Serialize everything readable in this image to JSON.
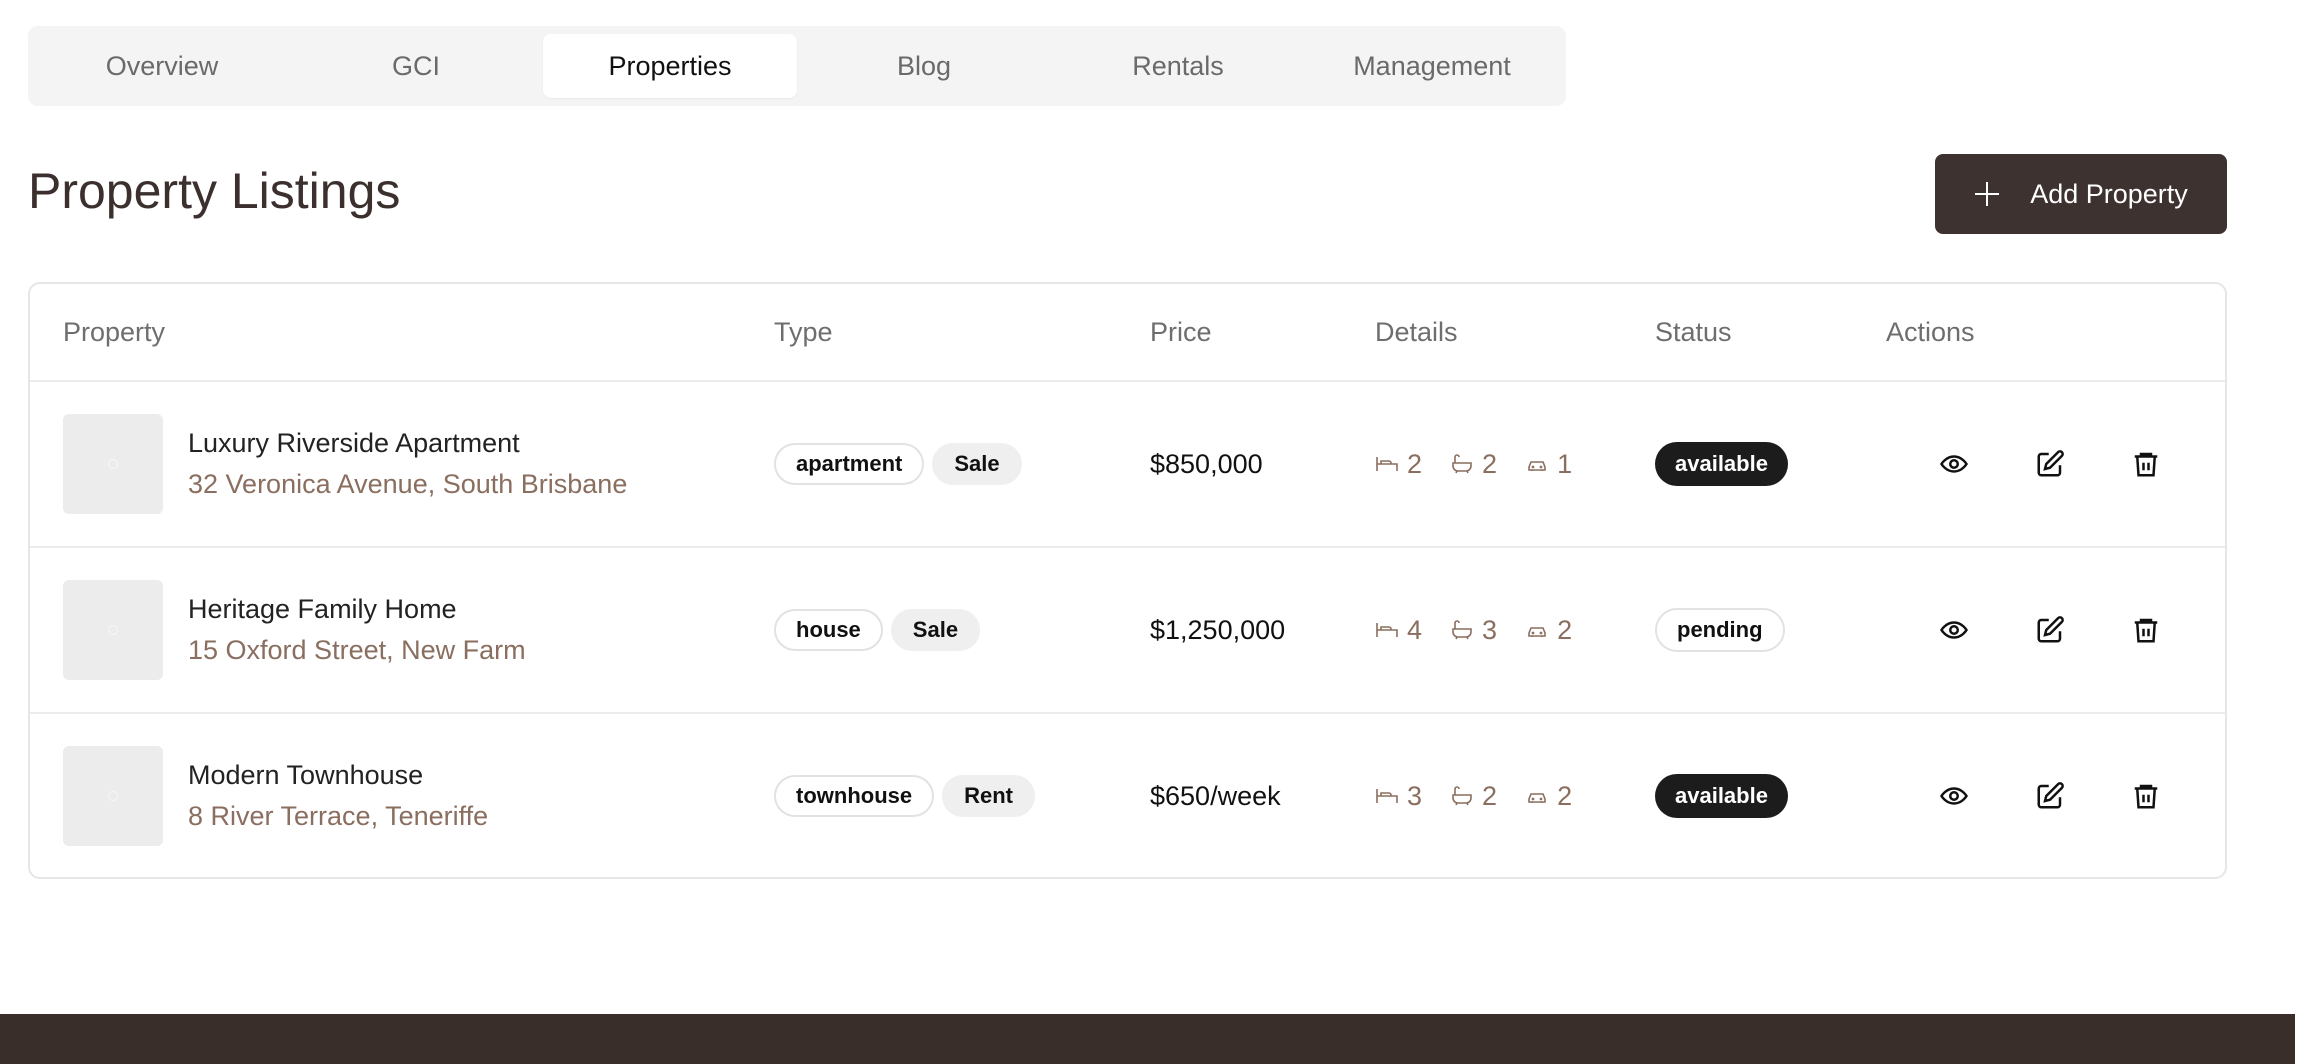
{
  "tabs": [
    {
      "label": "Overview",
      "active": false
    },
    {
      "label": "GCI",
      "active": false
    },
    {
      "label": "Properties",
      "active": true
    },
    {
      "label": "Blog",
      "active": false
    },
    {
      "label": "Rentals",
      "active": false
    },
    {
      "label": "Management",
      "active": false
    }
  ],
  "header": {
    "title": "Property Listings",
    "add_button_label": "Add Property",
    "add_button_icon": "plus-icon"
  },
  "table": {
    "columns": [
      "Property",
      "Type",
      "Price",
      "Details",
      "Status",
      "Actions"
    ],
    "rows": [
      {
        "name": "Luxury Riverside Apartment",
        "address": "32 Veronica Avenue, South Brisbane",
        "type": "apartment",
        "listing": "Sale",
        "price": "$850,000",
        "beds": "2",
        "baths": "2",
        "cars": "1",
        "status": "available"
      },
      {
        "name": "Heritage Family Home",
        "address": "15 Oxford Street, New Farm",
        "type": "house",
        "listing": "Sale",
        "price": "$1,250,000",
        "beds": "4",
        "baths": "3",
        "cars": "2",
        "status": "pending"
      },
      {
        "name": "Modern Townhouse",
        "address": "8 River Terrace, Teneriffe",
        "type": "townhouse",
        "listing": "Rent",
        "price": "$650/week",
        "beds": "3",
        "baths": "2",
        "cars": "2",
        "status": "available"
      }
    ],
    "action_icons": [
      "eye-icon",
      "edit-icon",
      "trash-icon"
    ],
    "detail_icons": [
      "bed-icon",
      "bath-icon",
      "car-icon"
    ]
  },
  "colors": {
    "brand_dark": "#3e3230",
    "muted_brown": "#8a6e5f",
    "footer": "#3a2e2b"
  }
}
